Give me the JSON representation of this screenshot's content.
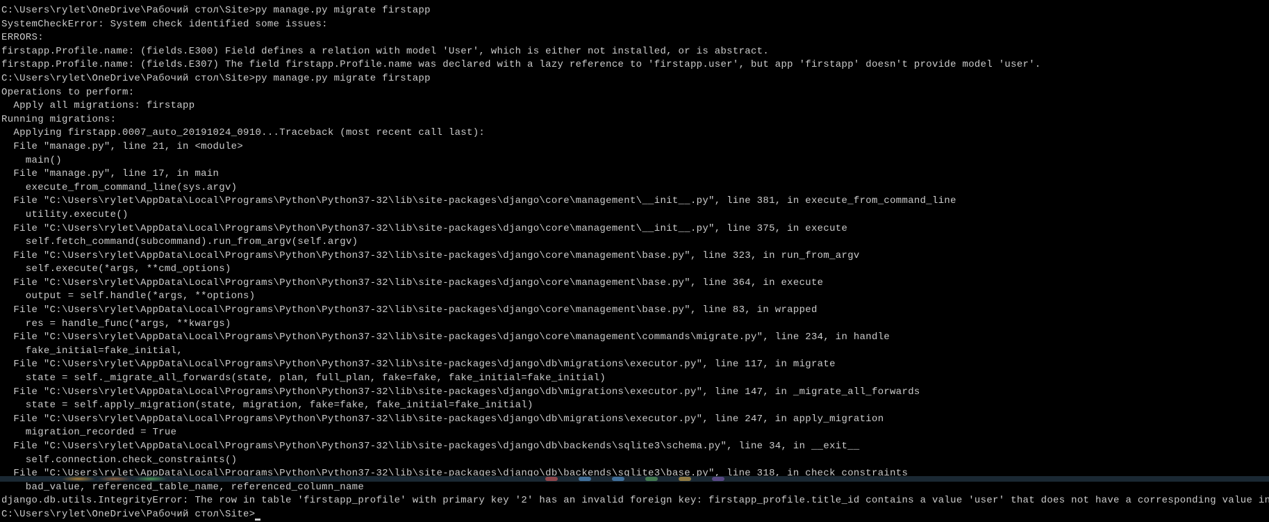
{
  "terminal": {
    "lines": [
      "C:\\Users\\rylet\\OneDrive\\Рабочий стол\\Site>py manage.py migrate firstapp",
      "SystemCheckError: System check identified some issues:",
      "",
      "ERRORS:",
      "firstapp.Profile.name: (fields.E300) Field defines a relation with model 'User', which is either not installed, or is abstract.",
      "firstapp.Profile.name: (fields.E307) The field firstapp.Profile.name was declared with a lazy reference to 'firstapp.user', but app 'firstapp' doesn't provide model 'user'.",
      "",
      "C:\\Users\\rylet\\OneDrive\\Рабочий стол\\Site>py manage.py migrate firstapp",
      "Operations to perform:",
      "  Apply all migrations: firstapp",
      "Running migrations:",
      "  Applying firstapp.0007_auto_20191024_0910...Traceback (most recent call last):",
      "  File \"manage.py\", line 21, in <module>",
      "    main()",
      "  File \"manage.py\", line 17, in main",
      "    execute_from_command_line(sys.argv)",
      "  File \"C:\\Users\\rylet\\AppData\\Local\\Programs\\Python\\Python37-32\\lib\\site-packages\\django\\core\\management\\__init__.py\", line 381, in execute_from_command_line",
      "    utility.execute()",
      "  File \"C:\\Users\\rylet\\AppData\\Local\\Programs\\Python\\Python37-32\\lib\\site-packages\\django\\core\\management\\__init__.py\", line 375, in execute",
      "    self.fetch_command(subcommand).run_from_argv(self.argv)",
      "  File \"C:\\Users\\rylet\\AppData\\Local\\Programs\\Python\\Python37-32\\lib\\site-packages\\django\\core\\management\\base.py\", line 323, in run_from_argv",
      "    self.execute(*args, **cmd_options)",
      "  File \"C:\\Users\\rylet\\AppData\\Local\\Programs\\Python\\Python37-32\\lib\\site-packages\\django\\core\\management\\base.py\", line 364, in execute",
      "    output = self.handle(*args, **options)",
      "  File \"C:\\Users\\rylet\\AppData\\Local\\Programs\\Python\\Python37-32\\lib\\site-packages\\django\\core\\management\\base.py\", line 83, in wrapped",
      "    res = handle_func(*args, **kwargs)",
      "  File \"C:\\Users\\rylet\\AppData\\Local\\Programs\\Python\\Python37-32\\lib\\site-packages\\django\\core\\management\\commands\\migrate.py\", line 234, in handle",
      "    fake_initial=fake_initial,",
      "  File \"C:\\Users\\rylet\\AppData\\Local\\Programs\\Python\\Python37-32\\lib\\site-packages\\django\\db\\migrations\\executor.py\", line 117, in migrate",
      "    state = self._migrate_all_forwards(state, plan, full_plan, fake=fake, fake_initial=fake_initial)",
      "  File \"C:\\Users\\rylet\\AppData\\Local\\Programs\\Python\\Python37-32\\lib\\site-packages\\django\\db\\migrations\\executor.py\", line 147, in _migrate_all_forwards",
      "    state = self.apply_migration(state, migration, fake=fake, fake_initial=fake_initial)",
      "  File \"C:\\Users\\rylet\\AppData\\Local\\Programs\\Python\\Python37-32\\lib\\site-packages\\django\\db\\migrations\\executor.py\", line 247, in apply_migration",
      "    migration_recorded = True",
      "  File \"C:\\Users\\rylet\\AppData\\Local\\Programs\\Python\\Python37-32\\lib\\site-packages\\django\\db\\backends\\sqlite3\\schema.py\", line 34, in __exit__",
      "    self.connection.check_constraints()",
      "  File \"C:\\Users\\rylet\\AppData\\Local\\Programs\\Python\\Python37-32\\lib\\site-packages\\django\\db\\backends\\sqlite3\\base.py\", line 318, in check_constraints",
      "    bad_value, referenced_table_name, referenced_column_name",
      "django.db.utils.IntegrityError: The row in table 'firstapp_profile' with primary key '2' has an invalid foreign key: firstapp_profile.title_id contains a value 'user' that does not have a corresponding value in auth_user.id.",
      "",
      "C:\\Users\\rylet\\OneDrive\\Рабочий стол\\Site>"
    ],
    "current_prompt": "C:\\Users\\rylet\\OneDrive\\Рабочий стол\\Site>"
  }
}
